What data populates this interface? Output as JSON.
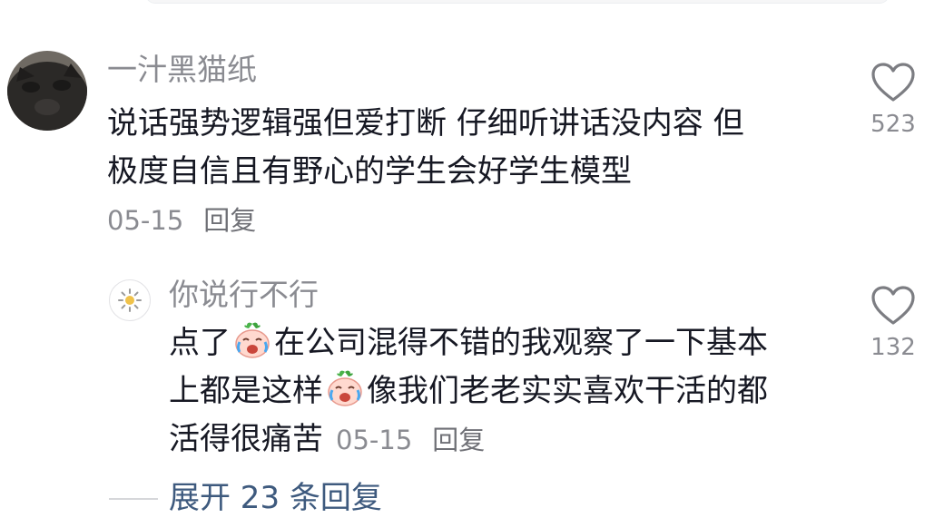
{
  "comment": {
    "username": "一汁黑猫纸",
    "text_line1": "说话强势逻辑强但爱打断 仔细听讲话没内容 但",
    "text_line2": "极度自信且有野心的学生会好学生模型",
    "date": "05-15",
    "reply_label": "回复",
    "like_count": "523",
    "avatar_icon": "black-cat-avatar",
    "like_icon": "heart-outline-icon"
  },
  "reply": {
    "username": "你说行不行",
    "avatar_icon": "sun-avatar",
    "line1_a": "点了",
    "line1_b": "在公司混得不错的我观察了一下基本",
    "line2_a": "上都是这样",
    "line2_b": "像我们老老实实喜欢干活的都",
    "line3": "活得很痛苦",
    "emoji_icon": "crying-laughing-onion-emoji",
    "date": "05-15",
    "reply_label": "回复",
    "like_count": "132",
    "like_icon": "heart-outline-icon"
  },
  "expand": {
    "label": "展开 23 条回复"
  },
  "colors": {
    "text": "#161823",
    "meta": "#8a8b91",
    "link": "#3e5a7e"
  }
}
